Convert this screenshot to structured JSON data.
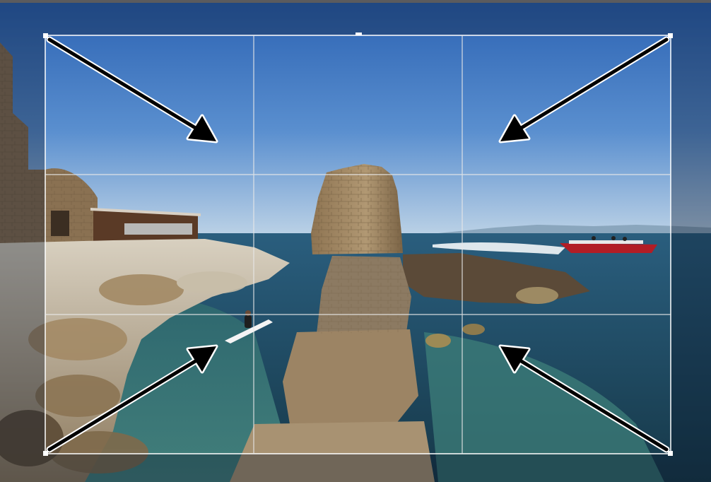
{
  "editor": {
    "mode": "crop",
    "overlay": "rule-of-thirds-grid",
    "grid_divisions": 3,
    "handles": [
      "top-left",
      "top-middle",
      "top-right",
      "bottom-left",
      "bottom-right"
    ],
    "guide_arrows": [
      "top-left",
      "top-right",
      "bottom-left",
      "bottom-right"
    ]
  },
  "photo": {
    "subject": "seaside-ruin-with-boat",
    "elements": [
      "sky",
      "sea",
      "rocky-shore",
      "stone-ruin",
      "stone-building",
      "speedboat",
      "paddleboarder",
      "jetty"
    ]
  },
  "colors": {
    "sky_top": "#2e66b5",
    "sky_horizon": "#b5cde0",
    "sea": "#1f4b64",
    "shallow_water": "#3a7a78",
    "rock": "#b39a73",
    "boat": "#b21d25",
    "grid_line": "#e8e8e8",
    "arrow": "#000000",
    "dim_overlay": "rgba(10,20,40,0.35)"
  }
}
